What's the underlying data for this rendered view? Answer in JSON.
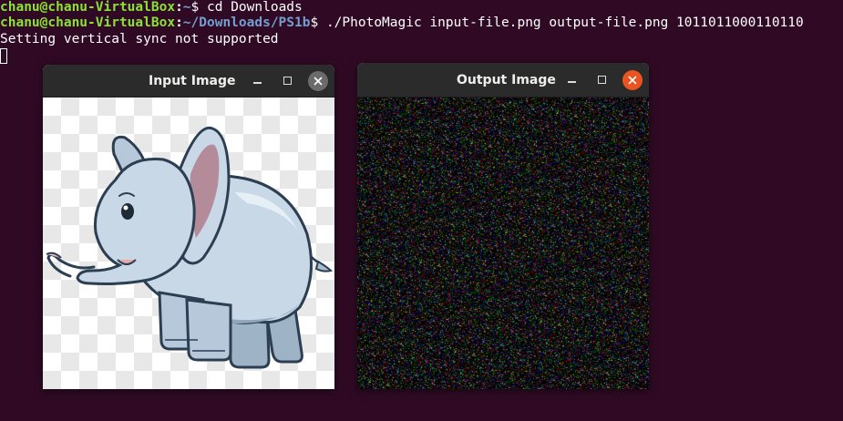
{
  "terminal": {
    "line1": {
      "user": "chanu@chanu-VirtualBox",
      "sep": ":",
      "path": "~",
      "prompt": "$ ",
      "command": "cd Downloads"
    },
    "line2": {
      "user": "chanu@chanu-VirtualBox",
      "sep": ":",
      "path": "~/Downloads/PS1b",
      "prompt": "$ ",
      "command": "./PhotoMagic input-file.png output-file.png 1011011000110110"
    },
    "line3": "Setting vertical sync not supported"
  },
  "windows": {
    "input": {
      "title": "Input Image",
      "image": "elephant-cartoon"
    },
    "output": {
      "title": "Output Image",
      "image": "random-color-noise"
    }
  },
  "colors": {
    "terminal_bg": "#300a24",
    "user": "#8ae234",
    "path": "#729fcf",
    "titlebar": "#2b2b2b",
    "close_active": "#e95420",
    "close_inactive": "#6b6b6b"
  },
  "icons": {
    "minimize": "minimize-icon",
    "maximize": "maximize-icon",
    "close": "close-icon"
  }
}
